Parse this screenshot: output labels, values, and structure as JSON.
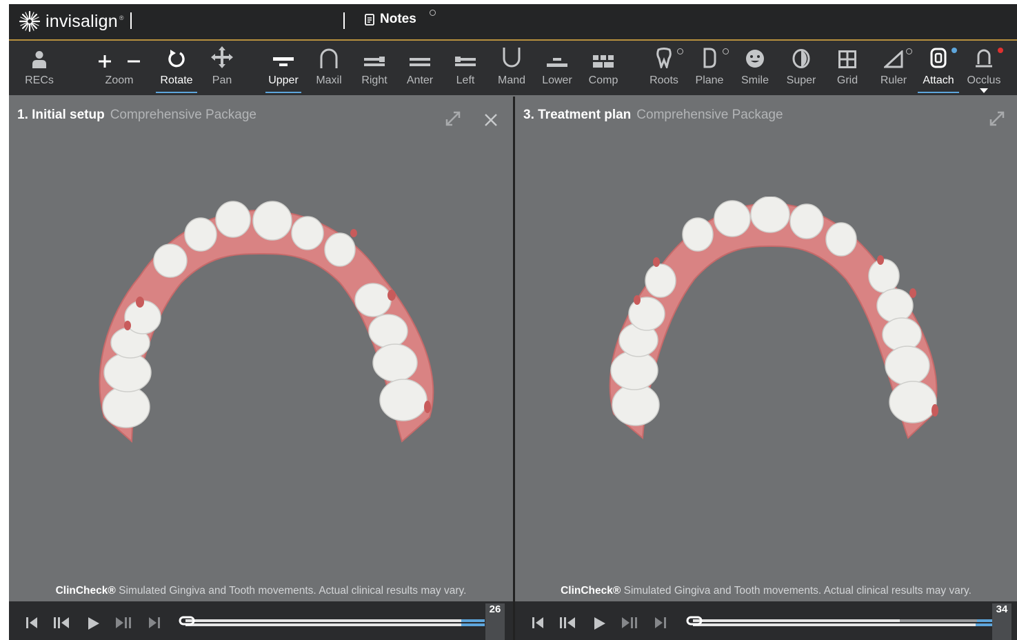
{
  "app": {
    "logo_text": "invisalign",
    "logo_tm": "®",
    "notes_label": "Notes"
  },
  "colors": {
    "accent": "#5ea6dc",
    "gold": "#b8913e",
    "alert_red": "#e0312f",
    "gum": "#d98383",
    "tooth": "#efefec"
  },
  "toolbar": {
    "items": [
      {
        "label": "RECs",
        "icon": "person-icon"
      },
      {
        "label": "Zoom",
        "icon": "plus-minus-icon"
      },
      {
        "label": "Rotate",
        "icon": "rotate-icon",
        "active": true
      },
      {
        "label": "Pan",
        "icon": "move-arrows-icon"
      },
      {
        "label": "Upper",
        "icon": "upper-view-icon",
        "active": true
      },
      {
        "label": "Maxil",
        "icon": "maxillary-arch-icon"
      },
      {
        "label": "Right",
        "icon": "right-view-icon"
      },
      {
        "label": "Anter",
        "icon": "anterior-view-icon"
      },
      {
        "label": "Left",
        "icon": "left-view-icon"
      },
      {
        "label": "Mand",
        "icon": "mandibular-arch-icon"
      },
      {
        "label": "Lower",
        "icon": "lower-view-icon"
      },
      {
        "label": "Comp",
        "icon": "compare-grid-icon"
      },
      {
        "label": "Roots",
        "icon": "tooth-root-icon"
      },
      {
        "label": "Plane",
        "icon": "plane-icon"
      },
      {
        "label": "Smile",
        "icon": "smile-face-icon"
      },
      {
        "label": "Super",
        "icon": "superimpose-icon"
      },
      {
        "label": "Grid",
        "icon": "grid-icon"
      },
      {
        "label": "Ruler",
        "icon": "ruler-icon"
      },
      {
        "label": "Attach",
        "icon": "attachment-icon",
        "active": true
      },
      {
        "label": "Occlus",
        "icon": "occlusion-icon"
      }
    ]
  },
  "panels": {
    "left": {
      "title": "1. Initial setup",
      "package": "Comprehensive Package",
      "stage": "26",
      "progress": 0.0
    },
    "right": {
      "title": "3. Treatment plan",
      "package": "Comprehensive Package",
      "stage": "34",
      "progress": 0.0
    }
  },
  "disclaimer": {
    "brand": "ClinCheck®",
    "text": " Simulated Gingiva and Tooth movements. Actual clinical results may vary."
  }
}
